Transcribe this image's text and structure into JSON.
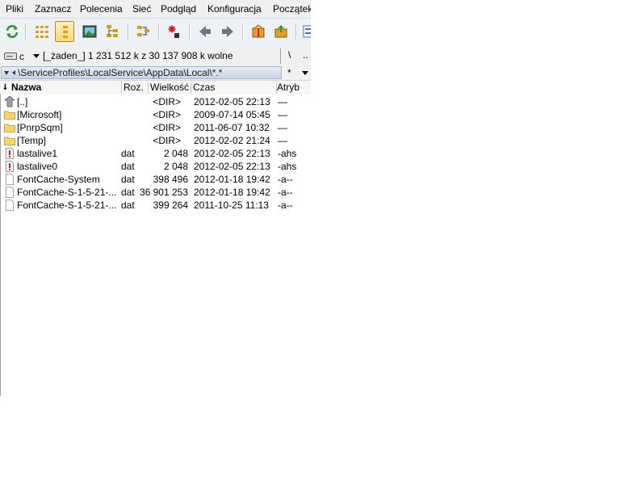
{
  "menu": [
    "Pliki",
    "Zaznacz",
    "Polecenia",
    "Sieć",
    "Podgląd",
    "Konfiguracja",
    "Początek"
  ],
  "toolbar": {
    "buttons": [
      {
        "name": "refresh-icon",
        "active": false
      },
      {
        "name": "brief-view-icon",
        "active": false
      },
      {
        "name": "detailed-view-icon",
        "active": true
      },
      {
        "name": "thumbnail-view-icon",
        "active": false
      },
      {
        "name": "tree-view-icon",
        "active": false
      },
      {
        "name": "invert-selection-icon",
        "active": false
      },
      {
        "name": "sync-dirs-icon",
        "active": false
      },
      {
        "name": "back-icon",
        "active": false
      },
      {
        "name": "forward-icon",
        "active": false
      },
      {
        "name": "pack-icon",
        "active": false
      },
      {
        "name": "unpack-icon",
        "active": false
      },
      {
        "name": "settings-icon",
        "active": false
      }
    ]
  },
  "drive": {
    "letter": "c",
    "info": "[_żaden_]  1 231 512 k z 30 137 908 k wolne",
    "root_label": "\\",
    "up_label": ".."
  },
  "path": {
    "text": "\\ServiceProfiles\\LocalService\\AppData\\Local\\*.*",
    "star_label": "*"
  },
  "columns": {
    "name": "Nazwa",
    "ext": "Roz.",
    "size": "Wielkość",
    "date": "Czas",
    "attr": "Atryb"
  },
  "files": [
    {
      "icon": "up-folder-icon",
      "name": "[..]",
      "ext": "",
      "size": "<DIR>",
      "date": "2012-02-05 22:13",
      "attr": "—"
    },
    {
      "icon": "folder-icon",
      "name": "[Microsoft]",
      "ext": "",
      "size": "<DIR>",
      "date": "2009-07-14 05:45",
      "attr": "—"
    },
    {
      "icon": "folder-icon",
      "name": "[PnrpSqm]",
      "ext": "",
      "size": "<DIR>",
      "date": "2011-06-07 10:32",
      "attr": "—"
    },
    {
      "icon": "folder-icon",
      "name": "[Temp]",
      "ext": "",
      "size": "<DIR>",
      "date": "2012-02-02 21:24",
      "attr": "—"
    },
    {
      "icon": "system-file-icon",
      "name": "lastalive1",
      "ext": "dat",
      "size": "2 048",
      "date": "2012-02-05 22:13",
      "attr": "-ahs"
    },
    {
      "icon": "system-file-icon",
      "name": "lastalive0",
      "ext": "dat",
      "size": "2 048",
      "date": "2012-02-05 22:13",
      "attr": "-ahs"
    },
    {
      "icon": "file-icon",
      "name": "FontCache-System",
      "ext": "dat",
      "size": "398 496",
      "date": "2012-01-18 19:42",
      "attr": "-a--"
    },
    {
      "icon": "file-icon",
      "name": "FontCache-S-1-5-21-...",
      "ext": "dat",
      "size": "36 901 253",
      "date": "2012-01-18 19:42",
      "attr": "-a--"
    },
    {
      "icon": "file-icon",
      "name": "FontCache-S-1-5-21-...",
      "ext": "dat",
      "size": "399 264",
      "date": "2011-10-25 11:13",
      "attr": "-a--"
    }
  ]
}
